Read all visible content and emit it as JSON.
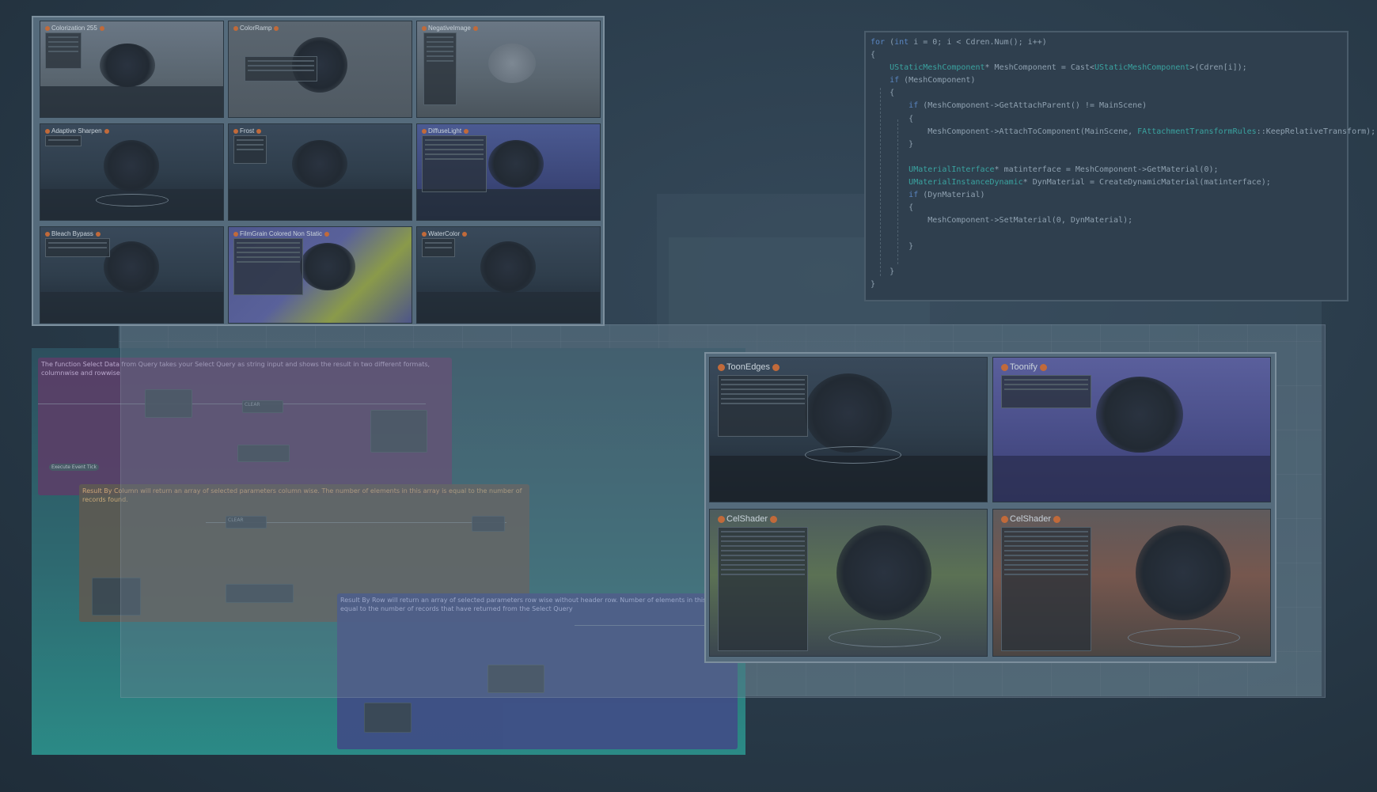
{
  "top_panel": {
    "thumbnails": [
      {
        "label": "Colorization 255"
      },
      {
        "label": "ColorRamp"
      },
      {
        "label": "NegativeImage"
      },
      {
        "label": "Adaptive Sharpen"
      },
      {
        "label": "Frost"
      },
      {
        "label": "DiffuseLight"
      },
      {
        "label": "Bleach Bypass"
      },
      {
        "label": "FilmGrain Colored Non Static"
      },
      {
        "label": "WaterColor"
      }
    ]
  },
  "right_panel": {
    "thumbnails": [
      {
        "label": "ToonEdges"
      },
      {
        "label": "Toonify"
      },
      {
        "label": "CelShader"
      },
      {
        "label": "CelShader"
      }
    ]
  },
  "graph": {
    "comment_pink": "The function Select Data from Query takes your Select Query as string input and shows the result in two different formats, columnwise and rowwise",
    "comment_orange": "Result By Column will return an array of selected parameters column wise. The number of elements in this array is equal to the number of records found.",
    "comment_blue": "Result By Row will return an array of selected parameters row wise without header row. Number of elements in this array is equal to the number of records that have returned from the Select Query",
    "chip_label": "Execute Event Tick",
    "node_label_1": "CLEAR",
    "node_label_2": "CLEAR"
  },
  "code": {
    "lines": [
      [
        {
          "t": "for",
          "c": "kw"
        },
        {
          "t": " ("
        },
        {
          "t": "int",
          "c": "kw"
        },
        {
          "t": " i = 0; i < Cdren.Num(); i++)"
        }
      ],
      [
        {
          "t": "{"
        }
      ],
      [
        {
          "t": "    "
        },
        {
          "t": "UStaticMeshComponent",
          "c": "ty"
        },
        {
          "t": "* MeshComponent = Cast<"
        },
        {
          "t": "UStaticMeshComponent",
          "c": "ty"
        },
        {
          "t": ">(Cdren[i]);"
        }
      ],
      [
        {
          "t": "    "
        },
        {
          "t": "if",
          "c": "kw"
        },
        {
          "t": " (MeshComponent)"
        }
      ],
      [
        {
          "t": "    {"
        }
      ],
      [
        {
          "t": "        "
        },
        {
          "t": "if",
          "c": "kw"
        },
        {
          "t": " (MeshComponent->GetAttachParent() != MainScene)"
        }
      ],
      [
        {
          "t": "        {"
        }
      ],
      [
        {
          "t": "            MeshComponent->AttachToComponent(MainScene, "
        },
        {
          "t": "FAttachmentTransformRules",
          "c": "ty"
        },
        {
          "t": "::KeepRelativeTransform);"
        }
      ],
      [
        {
          "t": "        }"
        }
      ],
      [
        {
          "t": ""
        }
      ],
      [
        {
          "t": "        "
        },
        {
          "t": "UMaterialInterface",
          "c": "ty"
        },
        {
          "t": "* matinterface = MeshComponent->GetMaterial(0);"
        }
      ],
      [
        {
          "t": "        "
        },
        {
          "t": "UMaterialInstanceDynamic",
          "c": "ty"
        },
        {
          "t": "* DynMaterial = CreateDynamicMaterial(matinterface);"
        }
      ],
      [
        {
          "t": "        "
        },
        {
          "t": "if",
          "c": "kw"
        },
        {
          "t": " (DynMaterial)"
        }
      ],
      [
        {
          "t": "        {"
        }
      ],
      [
        {
          "t": "            MeshComponent->SetMaterial(0, DynMaterial);"
        }
      ],
      [
        {
          "t": ""
        }
      ],
      [
        {
          "t": "        }"
        }
      ],
      [
        {
          "t": ""
        }
      ],
      [
        {
          "t": "    }"
        }
      ],
      [
        {
          "t": "}"
        }
      ]
    ]
  },
  "colors": {
    "background": "#2b3d4c",
    "keyword": "#5a86c2",
    "type": "#3aa3a0",
    "badge_dot": "#c16a3a"
  }
}
